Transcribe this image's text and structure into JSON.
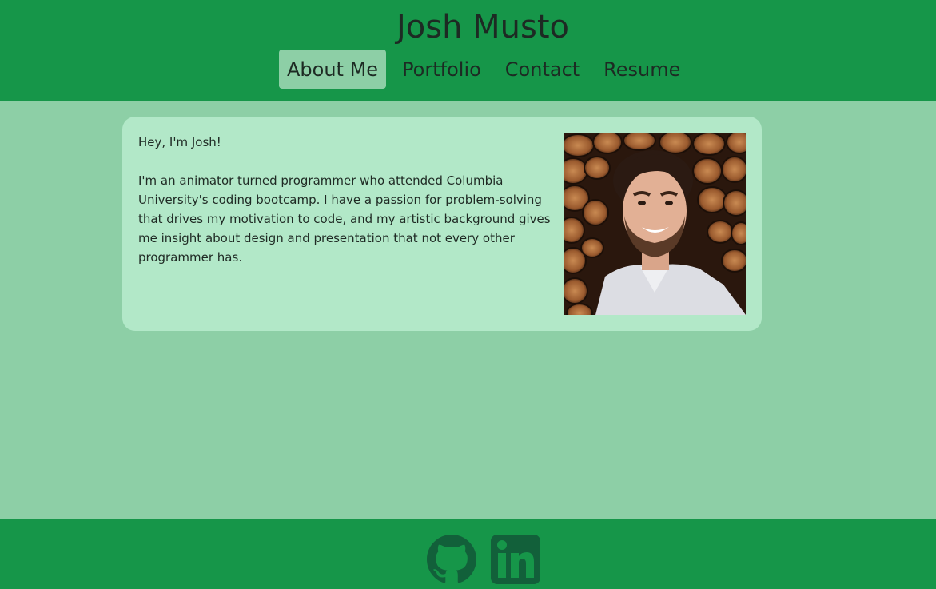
{
  "header": {
    "title": "Josh Musto",
    "nav": [
      {
        "label": "About Me",
        "active": true
      },
      {
        "label": "Portfolio",
        "active": false
      },
      {
        "label": "Contact",
        "active": false
      },
      {
        "label": "Resume",
        "active": false
      }
    ]
  },
  "about": {
    "greeting": "Hey, I'm Josh!",
    "bio": "I'm an animator turned programmer who attended Columbia University's coding bootcamp. I have a passion for problem-solving that drives my motivation to code, and my artistic background gives me insight about design and presentation that not every other programmer has.",
    "photo_icon": "profile-photo"
  },
  "footer": {
    "links": [
      {
        "icon": "github-icon"
      },
      {
        "icon": "linkedin-icon"
      }
    ]
  },
  "colors": {
    "header_bg": "#169649",
    "page_bg": "#8dcfa6",
    "card_bg": "#b2e8c8",
    "icon_color": "#12603a"
  }
}
